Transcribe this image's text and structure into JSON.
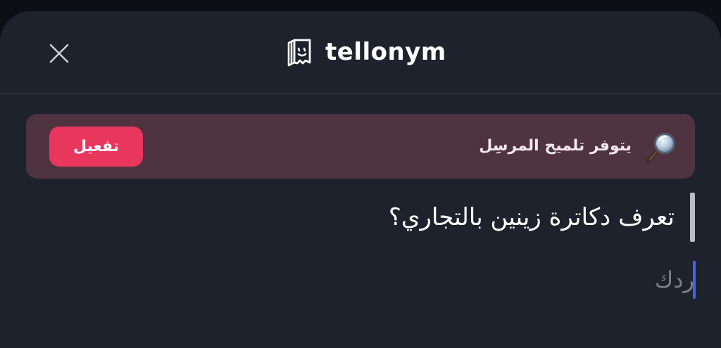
{
  "header": {
    "brand_name": "tellonym",
    "close_icon": "close-icon",
    "logo_icon": "tellonym-logo-icon"
  },
  "hint_banner": {
    "text": "يتوفر تلميح المرسِل",
    "icon": "magnifying-glass-icon",
    "activate_label": "تفعيل",
    "background_color": "#4f3341",
    "button_color": "#e8365d"
  },
  "question": {
    "text": "تعرف دكاترة زينين بالتجاري؟"
  },
  "reply": {
    "placeholder": "ردك",
    "value": "",
    "caret_color": "#3f63f5"
  }
}
